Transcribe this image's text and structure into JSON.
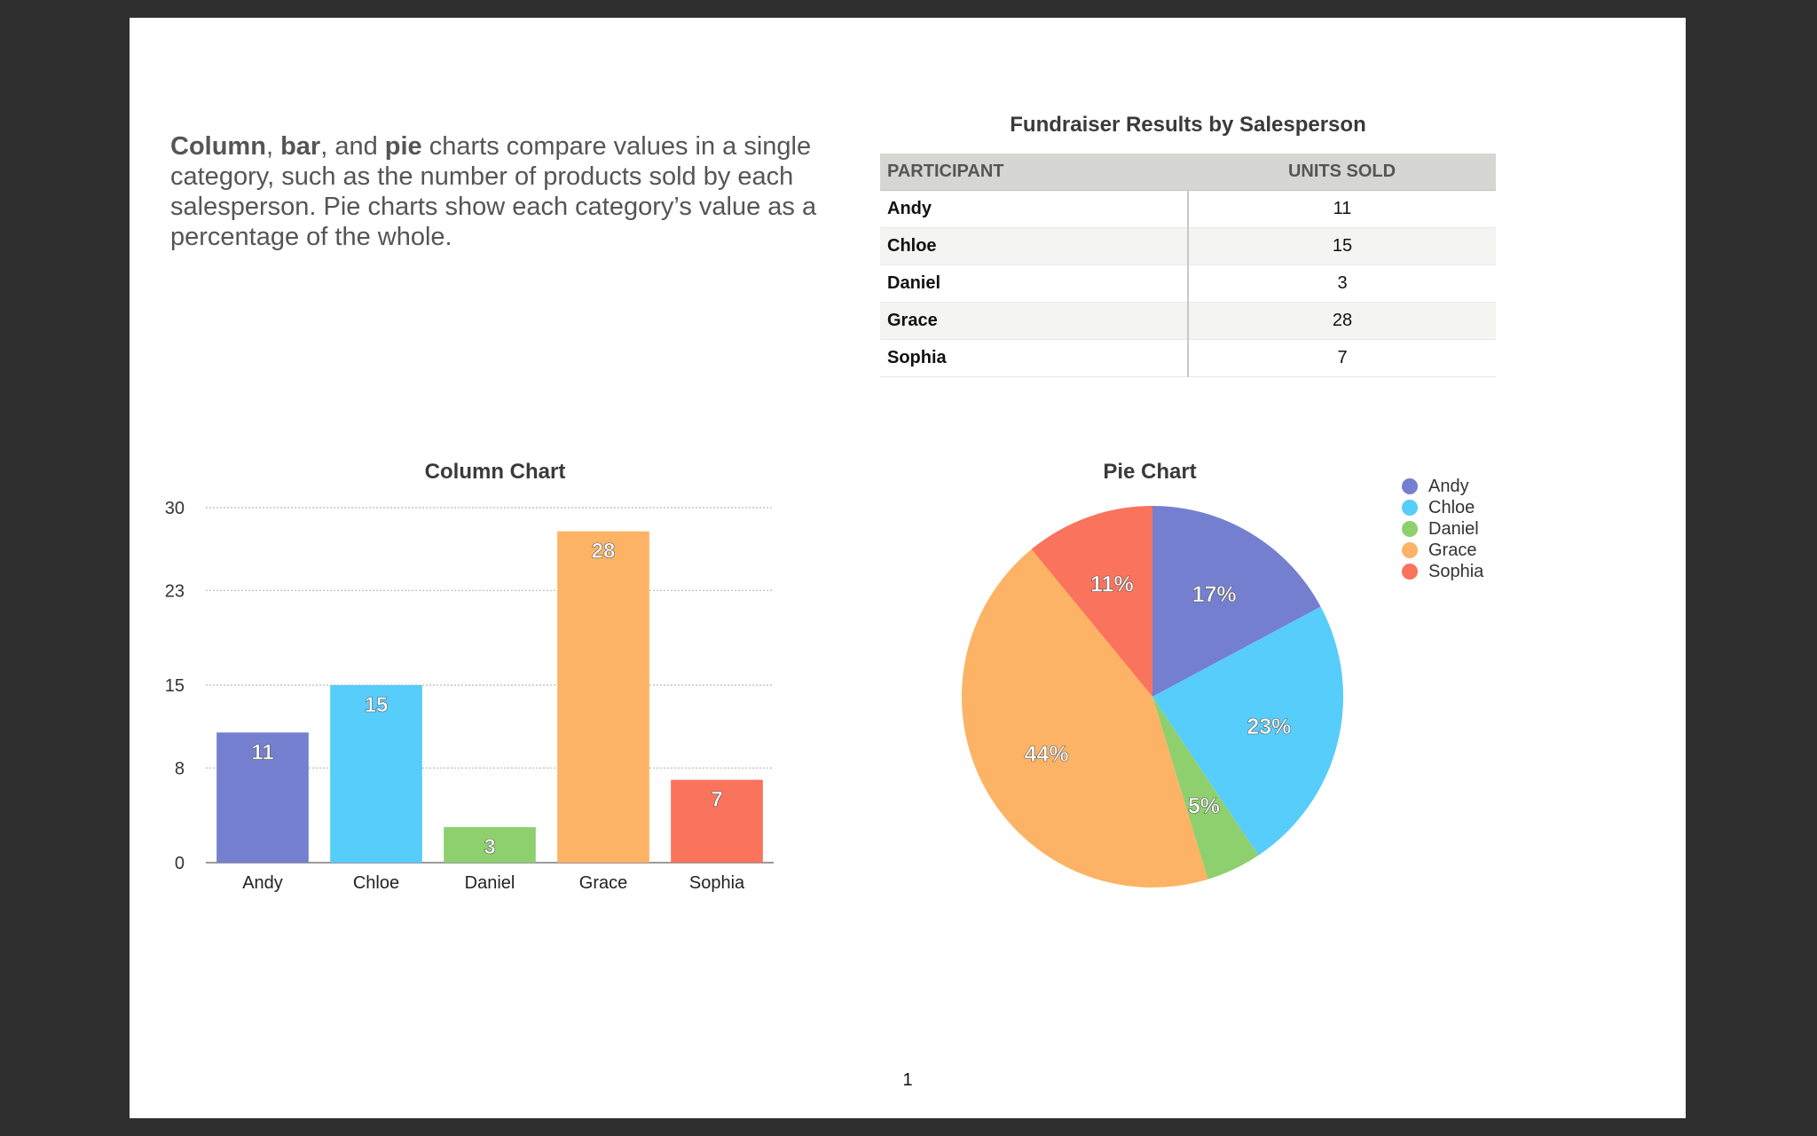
{
  "intro": {
    "bold1": "Column",
    "sep1": ", ",
    "bold2": "bar",
    "sep2": ", and ",
    "bold3": "pie",
    "rest": " charts compare values in a single category, such as the number of products sold by each salesperson. Pie charts show each category’s value as a percentage of the whole."
  },
  "table": {
    "title": "Fundraiser Results by Salesperson",
    "headers": [
      "PARTICIPANT",
      "UNITS SOLD"
    ],
    "rows": [
      [
        "Andy",
        "11"
      ],
      [
        "Chloe",
        "15"
      ],
      [
        "Daniel",
        "3"
      ],
      [
        "Grace",
        "28"
      ],
      [
        "Sophia",
        "7"
      ]
    ]
  },
  "colors": {
    "Andy": "#7480cf",
    "Chloe": "#56cdfb",
    "Daniel": "#8fd06e",
    "Grace": "#fdb365",
    "Sophia": "#f9735d"
  },
  "chart_data": [
    {
      "type": "bar",
      "title": "Column Chart",
      "categories": [
        "Andy",
        "Chloe",
        "Daniel",
        "Grace",
        "Sophia"
      ],
      "values": [
        11,
        15,
        3,
        28,
        7
      ],
      "data_labels": [
        "11",
        "15",
        "3",
        "28",
        "7"
      ],
      "yticks": [
        0,
        8,
        15,
        23,
        30
      ],
      "ylim": [
        0,
        30
      ],
      "xlabel": "",
      "ylabel": "",
      "grid": true
    },
    {
      "type": "pie",
      "title": "Pie Chart",
      "categories": [
        "Andy",
        "Chloe",
        "Daniel",
        "Grace",
        "Sophia"
      ],
      "values": [
        11,
        15,
        3,
        28,
        7
      ],
      "data_labels": [
        "17%",
        "23%",
        "5%",
        "44%",
        "11%"
      ],
      "legend": "top-right"
    }
  ],
  "page_number": "1"
}
